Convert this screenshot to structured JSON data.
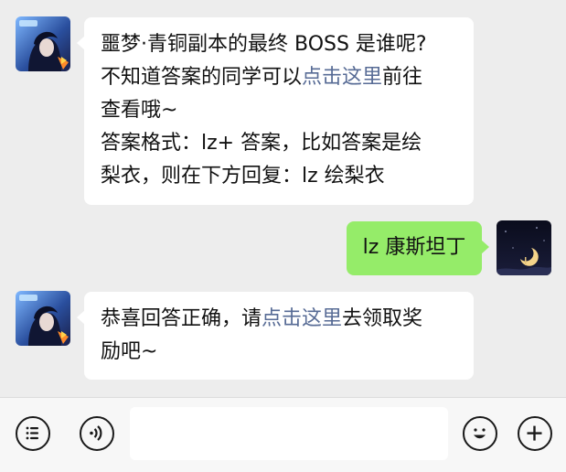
{
  "messages": [
    {
      "from": "game-account",
      "lines": [
        {
          "text": "噩梦·青铜副本的最终 BOSS 是谁呢?"
        },
        {
          "before": "不知道答案的同学可以",
          "link": "点击这里",
          "after": "前往"
        },
        {
          "text": "查看哦~"
        },
        {
          "text": "答案格式：lz+ 答案，比如答案是绘"
        },
        {
          "text": "梨衣，则在下方回复：lz 绘梨衣"
        }
      ]
    },
    {
      "from": "me",
      "text": "lz 康斯坦丁"
    },
    {
      "from": "game-account",
      "lines": [
        {
          "before": "恭喜回答正确，请",
          "link": "点击这里",
          "after": "去领取奖"
        },
        {
          "text": "励吧~"
        }
      ]
    }
  ],
  "colors": {
    "background": "#ededed",
    "incoming_bubble": "#ffffff",
    "outgoing_bubble": "#95ec69",
    "link": "#576b95"
  },
  "toolbar": {
    "icons": [
      "menu-icon",
      "voice-icon",
      "emoji-icon",
      "plus-icon"
    ],
    "input_value": ""
  }
}
